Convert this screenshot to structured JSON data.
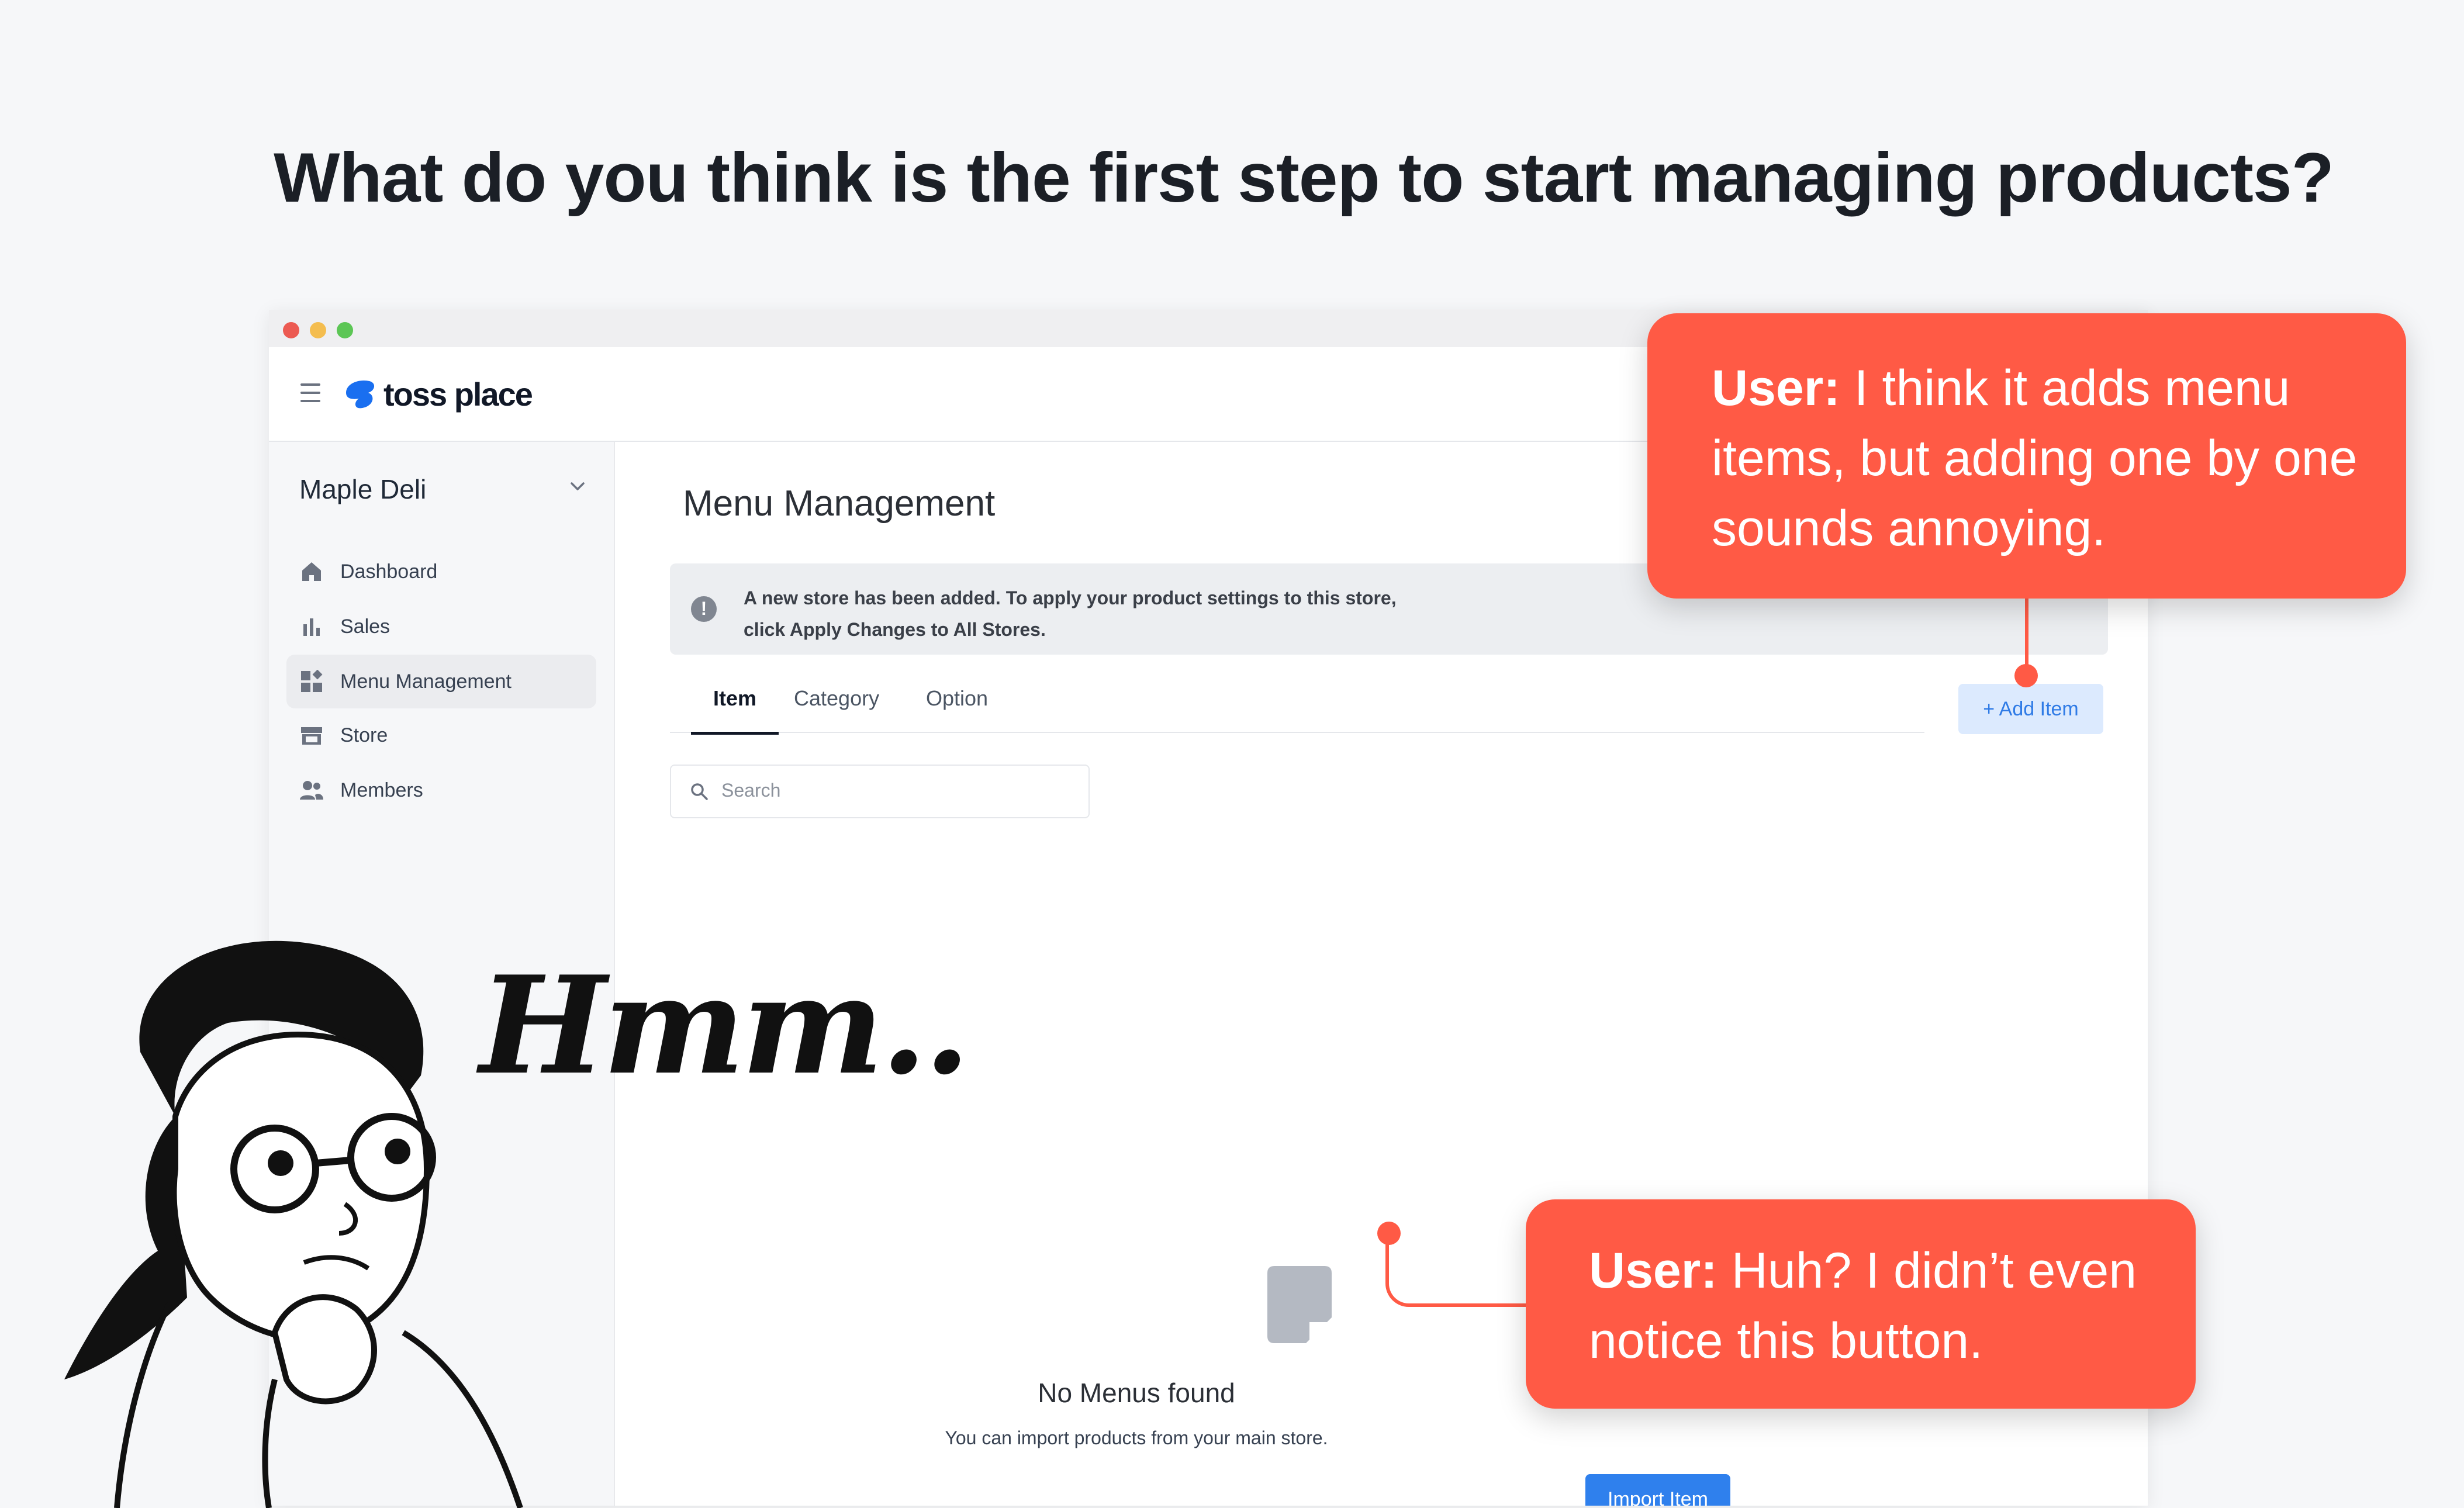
{
  "headline": "What do you think is the first step to start managing products?",
  "window": {
    "traffic_lights": [
      "close",
      "minimize",
      "maximize"
    ]
  },
  "header": {
    "menu_icon": "hamburger-icon",
    "logo_text": "toss place",
    "logo_color": "#1a6ff0"
  },
  "sidebar": {
    "store_name": "Maple Deli",
    "items": [
      {
        "label": "Dashboard",
        "icon": "home-icon",
        "active": false
      },
      {
        "label": "Sales",
        "icon": "bar-chart-icon",
        "active": false
      },
      {
        "label": "Menu Management",
        "icon": "grid-icon",
        "active": true
      },
      {
        "label": "Store",
        "icon": "store-icon",
        "active": false
      },
      {
        "label": "Members",
        "icon": "members-icon",
        "active": false
      }
    ]
  },
  "main": {
    "title": "Menu Management",
    "notice_line1": "A new store has been added. To apply your product settings to this store,",
    "notice_line2": "click Apply Changes to All Stores.",
    "tabs": [
      {
        "label": "Item",
        "active": true
      },
      {
        "label": "Category",
        "active": false
      },
      {
        "label": "Option",
        "active": false
      }
    ],
    "add_button": "+ Add Item",
    "search_placeholder": "Search",
    "empty_title": "No Menus found",
    "empty_subtitle": "You can import products from your main store.",
    "import_button": "Import Item"
  },
  "callouts": [
    {
      "speaker": "User:",
      "text": " I think it adds menu items, but adding one by one sounds annoying."
    },
    {
      "speaker": "User:",
      "text": " Huh? I didn’t even notice this button."
    }
  ],
  "illustration": {
    "thought": "Hmm.."
  },
  "colors": {
    "accent": "#ff5a45",
    "primary_button": "#2f80ed",
    "secondary_button_bg": "#dceafe"
  }
}
